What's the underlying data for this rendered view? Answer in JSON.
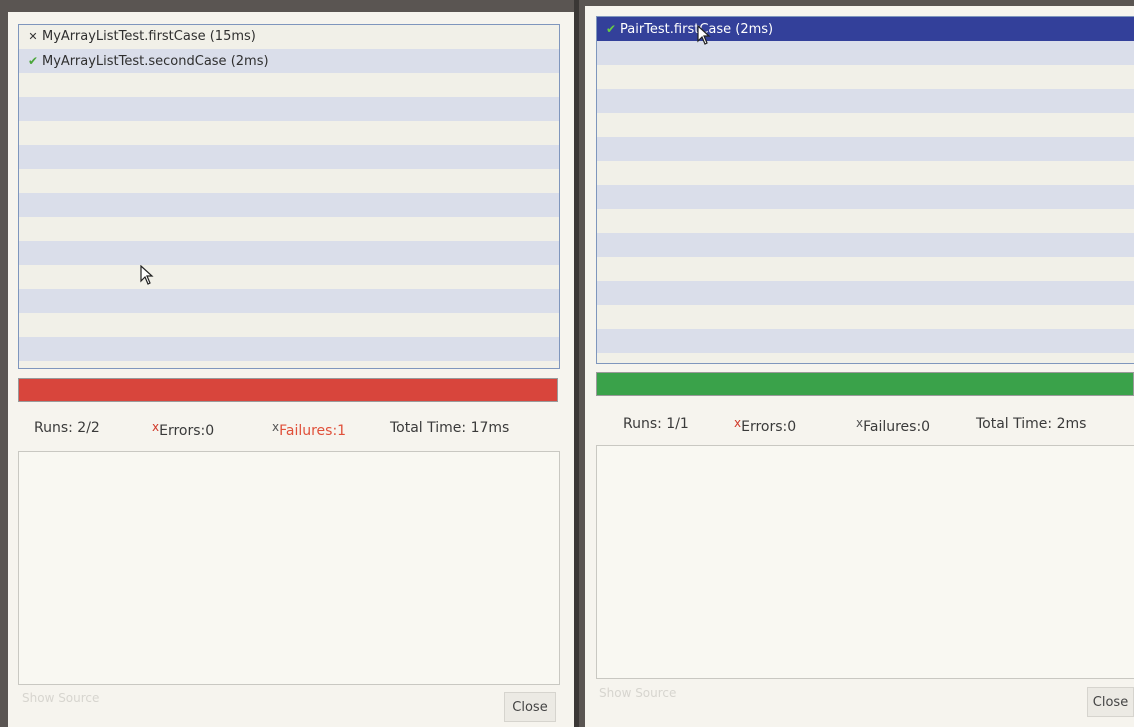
{
  "left_panel": {
    "tests": [
      {
        "status": "fail",
        "icon": "x-mark-icon",
        "glyph": "✕",
        "label": "MyArrayListTest.firstCase (15ms)"
      },
      {
        "status": "pass",
        "icon": "checkmark-icon",
        "glyph": "✔",
        "label": "MyArrayListTest.secondCase (2ms)"
      }
    ],
    "progress": {
      "value": 1.0,
      "color": "#d8453c"
    },
    "stats": {
      "runs": "Runs:  2/2",
      "errors_mark": "x",
      "errors": "Errors:0",
      "failures_mark": "x",
      "failures": "Failures:1",
      "total_time": "Total Time:  17ms"
    },
    "show_source_label": "Show Source",
    "close_label": "Close"
  },
  "right_panel": {
    "tests": [
      {
        "status": "pass",
        "icon": "checkmark-icon",
        "glyph": "✔",
        "label": "PairTest.firstCase (2ms)",
        "selected": true
      }
    ],
    "progress": {
      "value": 1.0,
      "color": "#3aa24a"
    },
    "stats": {
      "runs": "Runs:  1/1",
      "errors_mark": "x",
      "errors": "Errors:0",
      "failures_mark": "x",
      "failures": "Failures:0",
      "total_time": "Total Time:  2ms"
    },
    "show_source_label": "Show Source",
    "close_label": "Close"
  },
  "colors": {
    "selection": "#33409a",
    "fail_bar": "#d8453c",
    "pass_bar": "#3aa24a",
    "error_mark": "#d03a2a",
    "failure_text": "#e0503a"
  }
}
